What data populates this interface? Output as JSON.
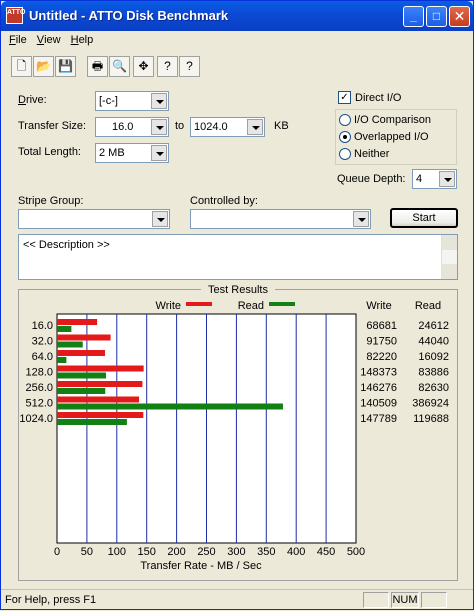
{
  "window": {
    "title": "Untitled - ATTO Disk Benchmark",
    "app_icon_text": "ATTO",
    "min_glyph": "_",
    "max_glyph": "□",
    "close_glyph": "✕"
  },
  "menu": [
    {
      "label": "File",
      "key": "F"
    },
    {
      "label": "View",
      "key": "V"
    },
    {
      "label": "Help",
      "key": "H"
    }
  ],
  "toolbar": [
    {
      "name": "new-document-icon",
      "glyph": "🗋"
    },
    {
      "name": "open-folder-icon",
      "glyph": "📂"
    },
    {
      "name": "save-icon",
      "glyph": "💾"
    },
    {
      "name": "print-icon",
      "glyph": "🖶"
    },
    {
      "name": "print-preview-icon",
      "glyph": "🔍"
    },
    {
      "name": "move-icon",
      "glyph": "✥"
    },
    {
      "name": "help-icon",
      "glyph": "?"
    },
    {
      "name": "context-help-icon",
      "glyph": "?"
    }
  ],
  "form": {
    "drive_label": "Drive:",
    "drive_value": "[-c-]",
    "transfer_label": "Transfer Size:",
    "transfer_from": "16.0",
    "to_label": "to",
    "transfer_to": "1024.0",
    "kb_label": "KB",
    "length_label": "Total Length:",
    "length_value": "2 MB",
    "direct_io": "Direct I/O",
    "io_comparison": "I/O Comparison",
    "overlapped_io": "Overlapped I/O",
    "neither": "Neither",
    "queue_label": "Queue Depth:",
    "queue_value": "4",
    "stripe_label": "Stripe Group:",
    "controlled_label": "Controlled by:",
    "start": "Start",
    "description": "<< Description >>",
    "check_glyph": "✓"
  },
  "chart_data": {
    "type": "bar",
    "title": "Test Results",
    "legend": [
      {
        "name": "Write",
        "color": "#e41a1a"
      },
      {
        "name": "Read",
        "color": "#138013"
      }
    ],
    "legend_placement": "top",
    "categories": [
      "16.0",
      "32.0",
      "64.0",
      "128.0",
      "256.0",
      "512.0",
      "1024.0"
    ],
    "series": [
      {
        "name": "Write",
        "color": "#e41a1a",
        "values": [
          68681,
          91750,
          82220,
          148373,
          146276,
          140509,
          147789
        ]
      },
      {
        "name": "Read",
        "color": "#138013",
        "values": [
          24612,
          44040,
          16092,
          83886,
          82630,
          386924,
          119688
        ]
      }
    ],
    "value_columns": {
      "write_header": "Write",
      "read_header": "Read"
    },
    "xlabel": "Transfer Rate - MB / Sec",
    "xticks": [
      "0",
      "50",
      "100",
      "150",
      "200",
      "250",
      "300",
      "350",
      "400",
      "450",
      "500"
    ],
    "xlim": [
      0,
      500
    ],
    "grid": true
  },
  "status": {
    "text": "For Help, press F1",
    "num": "NUM"
  }
}
